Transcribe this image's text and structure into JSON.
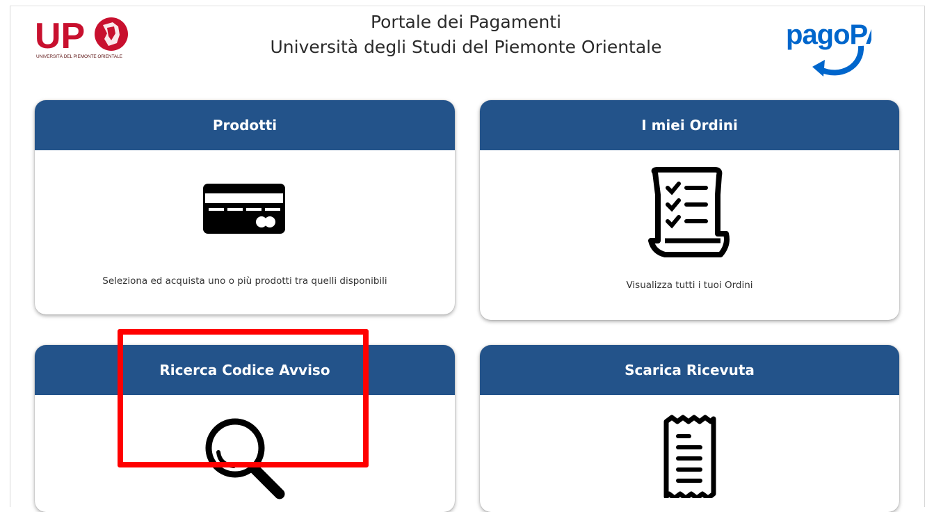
{
  "header": {
    "title_line1": "Portale dei Pagamenti",
    "title_line2": "Università degli Studi del Piemonte Orientale",
    "logo_left_text": "UP",
    "logo_left_subtitle": "UNIVERSITÀ DEL PIEMONTE ORIENTALE",
    "logo_right_text": "pagoPA"
  },
  "cards": [
    {
      "title": "Prodotti",
      "description": "Seleziona ed acquista uno o più prodotti tra quelli disponibili",
      "icon": "credit-card-icon"
    },
    {
      "title": "I miei Ordini",
      "description": "Visualizza tutti i tuoi Ordini",
      "icon": "checklist-scroll-icon"
    },
    {
      "title": "Ricerca Codice Avviso",
      "description": "",
      "icon": "magnifier-icon"
    },
    {
      "title": "Scarica Ricevuta",
      "description": "",
      "icon": "receipt-icon"
    }
  ],
  "colors": {
    "card_header": "#23538a",
    "upo_red": "#c8102e",
    "pagopa_blue": "#0066cc",
    "highlight": "#ff0000"
  }
}
